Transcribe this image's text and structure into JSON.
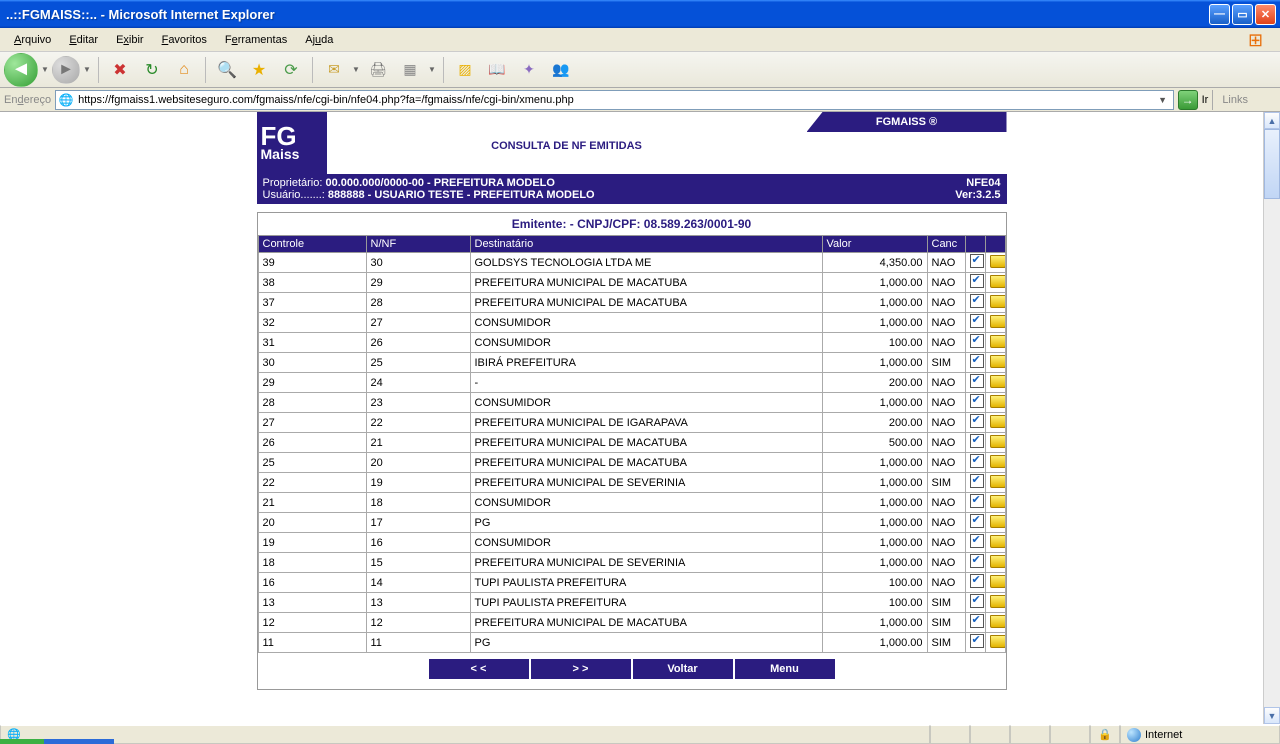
{
  "window": {
    "title": "..::FGMAISS::.. - Microsoft Internet Explorer"
  },
  "menu": {
    "items": [
      "Arquivo",
      "Editar",
      "Exibir",
      "Favoritos",
      "Ferramentas",
      "Ajuda"
    ]
  },
  "address": {
    "label": "Endereço",
    "url": "https://fgmaiss1.websiteseguro.com/fgmaiss/nfe/cgi-bin/nfe04.php?fa=/fgmaiss/nfe/cgi-bin/xmenu.php",
    "go": "Ir",
    "links": "Links"
  },
  "brand": "FGMAISS ®",
  "page_title": "CONSULTA DE NF EMITIDAS",
  "owner": {
    "label": "Proprietário:",
    "value": "00.000.000/0000-00 - PREFEITURA MODELO",
    "code": "NFE04"
  },
  "user": {
    "label": "Usuário.......:",
    "value": "888888 - USUARIO TESTE - PREFEITURA MODELO",
    "ver": "Ver:3.2.5"
  },
  "emitente": "Emitente: - CNPJ/CPF: 08.589.263/0001-90",
  "columns": {
    "controle": "Controle",
    "nnf": "N/NF",
    "dest": "Destinatário",
    "valor": "Valor",
    "canc": "Canc"
  },
  "rows": [
    {
      "c": "39",
      "n": "30",
      "d": "GOLDSYS TECNOLOGIA LTDA ME",
      "v": "4,350.00",
      "canc": "NAO"
    },
    {
      "c": "38",
      "n": "29",
      "d": "PREFEITURA MUNICIPAL DE MACATUBA",
      "v": "1,000.00",
      "canc": "NAO"
    },
    {
      "c": "37",
      "n": "28",
      "d": "PREFEITURA MUNICIPAL DE MACATUBA",
      "v": "1,000.00",
      "canc": "NAO"
    },
    {
      "c": "32",
      "n": "27",
      "d": "CONSUMIDOR",
      "v": "1,000.00",
      "canc": "NAO"
    },
    {
      "c": "31",
      "n": "26",
      "d": "CONSUMIDOR",
      "v": "100.00",
      "canc": "NAO"
    },
    {
      "c": "30",
      "n": "25",
      "d": "IBIRÁ PREFEITURA",
      "v": "1,000.00",
      "canc": "SIM"
    },
    {
      "c": "29",
      "n": "24",
      "d": "-",
      "v": "200.00",
      "canc": "NAO"
    },
    {
      "c": "28",
      "n": "23",
      "d": "CONSUMIDOR",
      "v": "1,000.00",
      "canc": "NAO"
    },
    {
      "c": "27",
      "n": "22",
      "d": "PREFEITURA MUNICIPAL DE IGARAPAVA",
      "v": "200.00",
      "canc": "NAO"
    },
    {
      "c": "26",
      "n": "21",
      "d": "PREFEITURA MUNICIPAL DE MACATUBA",
      "v": "500.00",
      "canc": "NAO"
    },
    {
      "c": "25",
      "n": "20",
      "d": "PREFEITURA MUNICIPAL DE MACATUBA",
      "v": "1,000.00",
      "canc": "NAO"
    },
    {
      "c": "22",
      "n": "19",
      "d": "PREFEITURA MUNICIPAL DE SEVERINIA",
      "v": "1,000.00",
      "canc": "SIM"
    },
    {
      "c": "21",
      "n": "18",
      "d": "CONSUMIDOR",
      "v": "1,000.00",
      "canc": "NAO"
    },
    {
      "c": "20",
      "n": "17",
      "d": "PG",
      "v": "1,000.00",
      "canc": "NAO"
    },
    {
      "c": "19",
      "n": "16",
      "d": "CONSUMIDOR",
      "v": "1,000.00",
      "canc": "NAO"
    },
    {
      "c": "18",
      "n": "15",
      "d": "PREFEITURA MUNICIPAL DE SEVERINIA",
      "v": "1,000.00",
      "canc": "NAO"
    },
    {
      "c": "16",
      "n": "14",
      "d": "TUPI PAULISTA PREFEITURA",
      "v": "100.00",
      "canc": "NAO"
    },
    {
      "c": "13",
      "n": "13",
      "d": "TUPI PAULISTA PREFEITURA",
      "v": "100.00",
      "canc": "SIM"
    },
    {
      "c": "12",
      "n": "12",
      "d": "PREFEITURA MUNICIPAL DE MACATUBA",
      "v": "1,000.00",
      "canc": "SIM"
    },
    {
      "c": "11",
      "n": "11",
      "d": "PG",
      "v": "1,000.00",
      "canc": "SIM"
    }
  ],
  "nav": {
    "prev": "< <",
    "next": "> >",
    "voltar": "Voltar",
    "menu": "Menu"
  },
  "status": {
    "zone": "Internet"
  }
}
